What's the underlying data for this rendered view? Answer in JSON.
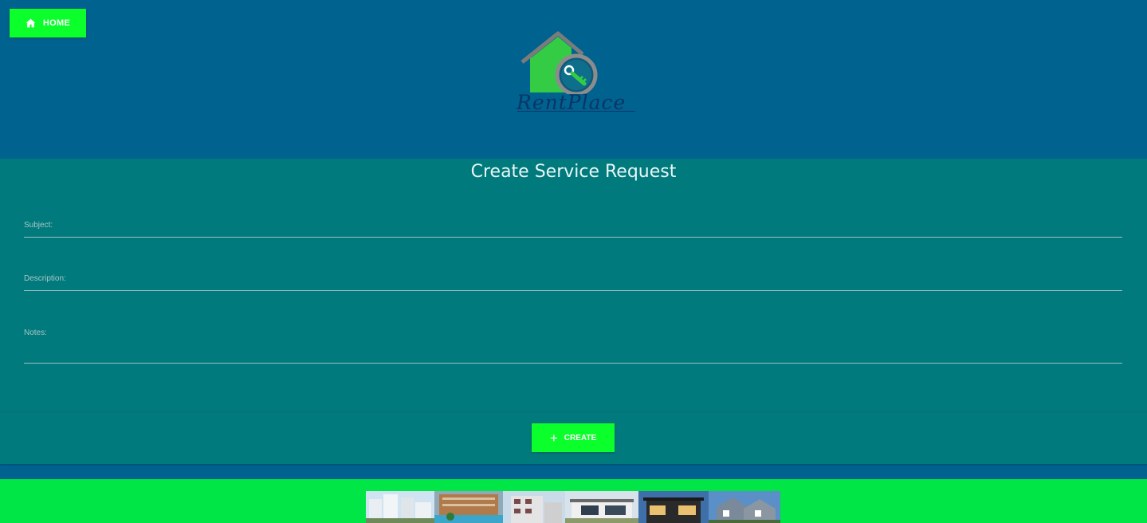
{
  "nav": {
    "home_label": "HOME",
    "home_icon": "home-icon"
  },
  "logo": {
    "text": "RentPlace",
    "colors": {
      "house": "#33cc44",
      "roof": "#7b7b7b",
      "magnifier": "#8c8c8c",
      "text": "#0a3566"
    }
  },
  "form": {
    "title": "Create Service Request",
    "fields": [
      {
        "label": "Subject:",
        "value": ""
      },
      {
        "label": "Description:",
        "value": ""
      },
      {
        "label": "Notes:",
        "value": ""
      }
    ],
    "create_label": "CREATE",
    "create_icon": "plus-icon"
  },
  "colors": {
    "header_bg": "#00628f",
    "panel_bg": "#007a7c",
    "accent": "#0bff2b",
    "footer_bg": "#00e646"
  }
}
